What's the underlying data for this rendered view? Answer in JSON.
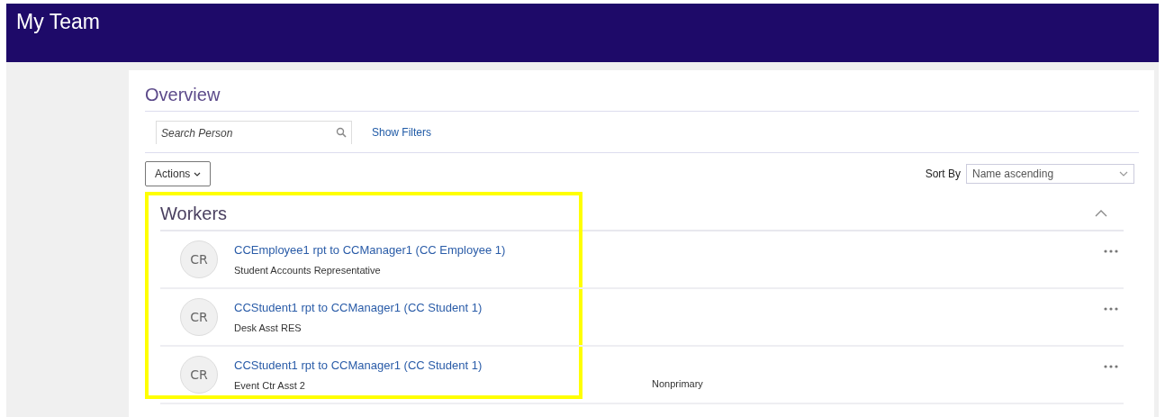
{
  "header": {
    "title": "My Team"
  },
  "overview": {
    "title": "Overview",
    "search": {
      "placeholder": "Search Person"
    },
    "filters_link": "Show Filters",
    "actions_button": "Actions",
    "sort": {
      "label": "Sort By",
      "value": "Name ascending"
    }
  },
  "workers": {
    "title": "Workers",
    "expanded": true,
    "rows": [
      {
        "initials": "CR",
        "name": "CCEmployee1 rpt to CCManager1 (CC Employee 1)",
        "job": "Student Accounts Representative"
      },
      {
        "initials": "CR",
        "name": "CCStudent1 rpt to CCManager1 (CC Student 1)",
        "job": "Desk Asst RES"
      },
      {
        "initials": "CR",
        "name": "CCStudent1 rpt to CCManager1 (CC Student 1)",
        "job": "Event Ctr Asst 2",
        "assignment": "Nonprimary"
      }
    ]
  }
}
